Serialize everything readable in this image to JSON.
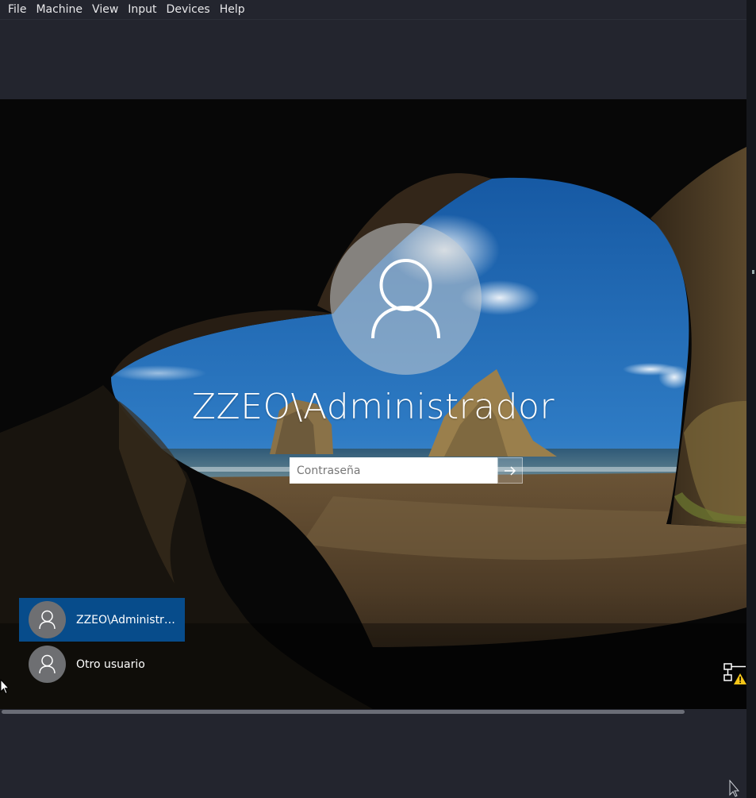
{
  "menubar": {
    "items": [
      "File",
      "Machine",
      "View",
      "Input",
      "Devices",
      "Help"
    ]
  },
  "login": {
    "username": "ZZEO\\Administrador",
    "password_placeholder": "Contraseña",
    "submit_icon": "arrow-right-icon"
  },
  "user_list": [
    {
      "label": "ZZEO\\Administra...",
      "selected": true
    },
    {
      "label": "Otro usuario",
      "selected": false
    }
  ],
  "tray": {
    "network_icon": "network-warning-icon"
  },
  "colors": {
    "menubar_bg": "#23252e",
    "selected_user": "#074c8b",
    "warning": "#f5c518"
  }
}
